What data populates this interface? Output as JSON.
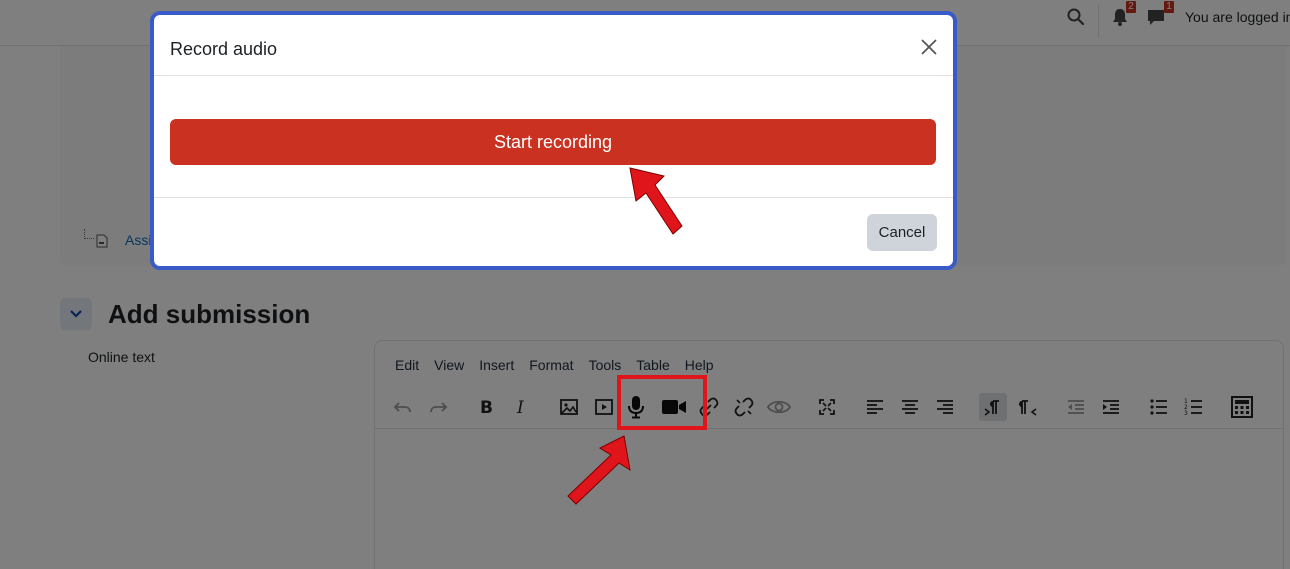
{
  "navbar": {
    "notification_count": "2",
    "message_count": "1",
    "user_text": "You are logged in"
  },
  "activity": {
    "link_text": "Assi"
  },
  "section": {
    "title": "Add submission",
    "online_text_label": "Online text"
  },
  "editor": {
    "menu": [
      "Edit",
      "View",
      "Insert",
      "Format",
      "Tools",
      "Table",
      "Help"
    ]
  },
  "modal": {
    "title": "Record audio",
    "start_button": "Start recording",
    "cancel_button": "Cancel"
  },
  "colors": {
    "record_red": "#ca3120",
    "modal_border": "#3a5bc7",
    "annotation_red": "#e0141b",
    "link_blue": "#0f6cbf"
  }
}
